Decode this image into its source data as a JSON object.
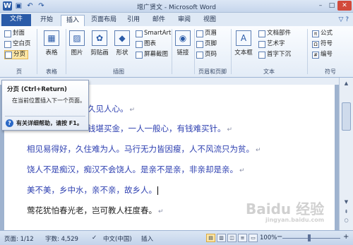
{
  "window": {
    "title": "增广贤文 - Microsoft Word",
    "minimize": "–",
    "maximize": "□",
    "close": "✕"
  },
  "qat": {
    "logo": "W",
    "save": "▣",
    "undo": "↶",
    "redo": "↷"
  },
  "tabs": [
    {
      "label": "文件"
    },
    {
      "label": "开始"
    },
    {
      "label": "插入"
    },
    {
      "label": "页面布局"
    },
    {
      "label": "引用"
    },
    {
      "label": "邮件"
    },
    {
      "label": "审阅"
    },
    {
      "label": "视图"
    }
  ],
  "tabs_right": "▽ ?",
  "ribbon": {
    "pages": {
      "cover": "封面",
      "blank": "空白页",
      "break": "分页",
      "group": "页"
    },
    "tables": {
      "table": "表格",
      "group": "表格"
    },
    "illustrations": {
      "picture": "图片",
      "clipart": "剪贴画",
      "shapes": "形状",
      "smartart": "SmartArt",
      "chart": "图表",
      "screenshot": "屏幕截图",
      "group": "插图"
    },
    "links": {
      "link": "链接"
    },
    "header_footer": {
      "header": "页眉",
      "footer": "页脚",
      "page_number": "页码",
      "group": "页眉和页脚"
    },
    "text": {
      "textbox": "文本框",
      "quickparts": "文档部件",
      "wordart": "艺术字",
      "dropcap": "首字下沉",
      "group": "文本"
    },
    "symbols": {
      "equation": "公式",
      "symbol": "符号",
      "number": "编号",
      "group": "符号"
    }
  },
  "tooltip": {
    "title": "分页 (Ctrl+Return)",
    "description": "在当前位置插入下一个页面。",
    "help": "有关详细帮助，请按 F1。"
  },
  "document": {
    "lines": [
      "久见人心。",
      "钱堪买金，一人一般心，有钱难买针。",
      "相见易得好，久住难为人。马行无力皆因瘦，人不风流只为贫。",
      "饶人不是痴汉，痴汉不会饶人。是亲不是亲，非亲却是亲。",
      "美不美，乡中水，亲不亲，故乡人。",
      "莺花犹怕春光老，岂可教人枉度春。"
    ],
    "para_mark": "↵"
  },
  "status": {
    "page": "页面: 1/12",
    "words": "字数: 4,529",
    "language": "中文(中国)",
    "mode": "插入",
    "zoom": "100%",
    "zoom_level": 1.0
  },
  "watermark": {
    "text": "Baidu 经验",
    "sub": "jingyan.baidu.com"
  },
  "colors": {
    "accent": "#2a5ba8",
    "doc_text": "#2d3fb0",
    "highlight": "#fde7a6"
  }
}
